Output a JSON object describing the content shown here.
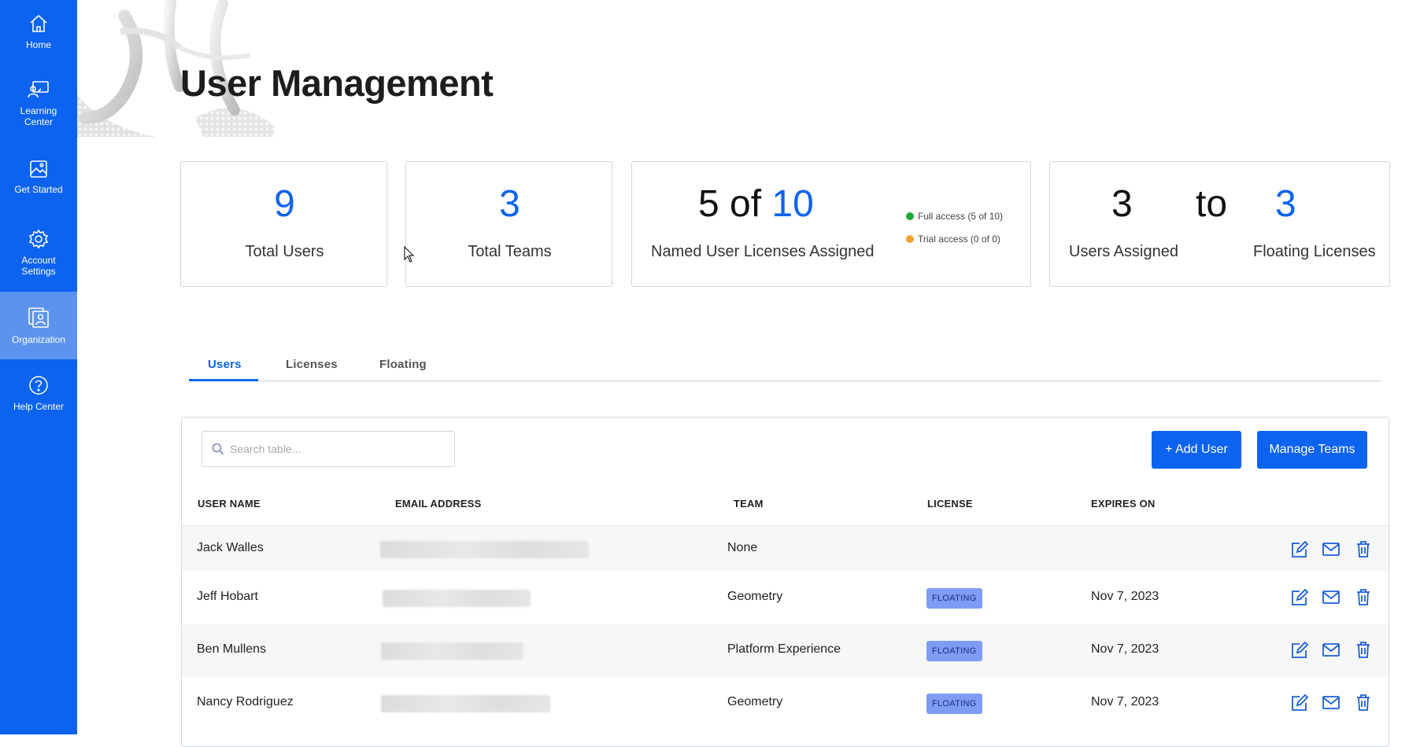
{
  "sidebar": {
    "items": [
      {
        "label": "Home",
        "icon": "home-icon"
      },
      {
        "label": "Learning Center",
        "icon": "learning-center-icon"
      },
      {
        "label": "Get Started",
        "icon": "image-icon"
      },
      {
        "label": "Account Settings",
        "icon": "gear-icon"
      },
      {
        "label": "Organization",
        "icon": "organization-icon",
        "active": true
      },
      {
        "label": "Help Center",
        "icon": "help-icon"
      }
    ]
  },
  "header": {
    "title": "User Management"
  },
  "stats": {
    "total_users": {
      "value": "9",
      "label": "Total Users"
    },
    "total_teams": {
      "value": "3",
      "label": "Total Teams"
    },
    "named_licenses": {
      "assigned": "5",
      "of": "of",
      "total": "10",
      "label": "Named User Licenses Assigned",
      "legend_full": "Full access (5 of 10)",
      "legend_trial": "Trial access (0 of 0)"
    },
    "floating": {
      "users_assigned": "3",
      "to": "to",
      "floating_licenses": "3",
      "users_label": "Users Assigned",
      "floating_label": "Floating Licenses"
    }
  },
  "tabs": [
    {
      "label": "Users",
      "active": true
    },
    {
      "label": "Licenses"
    },
    {
      "label": "Floating"
    }
  ],
  "table": {
    "search_placeholder": "Search table...",
    "add_user_label": "+ Add User",
    "manage_teams_label": "Manage Teams",
    "columns": [
      "USER NAME",
      "EMAIL ADDRESS",
      "TEAM",
      "LICENSE",
      "EXPIRES ON"
    ],
    "rows": [
      {
        "name": "Jack Walles",
        "team": "None",
        "license": "",
        "expires": ""
      },
      {
        "name": "Jeff Hobart",
        "team": "Geometry",
        "license": "FLOATING",
        "expires": "Nov 7, 2023"
      },
      {
        "name": "Ben Mullens",
        "team": "Platform Experience",
        "license": "FLOATING",
        "expires": "Nov 7, 2023"
      },
      {
        "name": "Nancy Rodriguez",
        "team": "Geometry",
        "license": "FLOATING",
        "expires": "Nov 7, 2023"
      }
    ]
  },
  "colors": {
    "brand": "#0c63f0",
    "sidebar_active": "#5c93ee",
    "full_access": "#1faa3a",
    "trial_access": "#f0a030",
    "badge": "#7f9cf5"
  }
}
